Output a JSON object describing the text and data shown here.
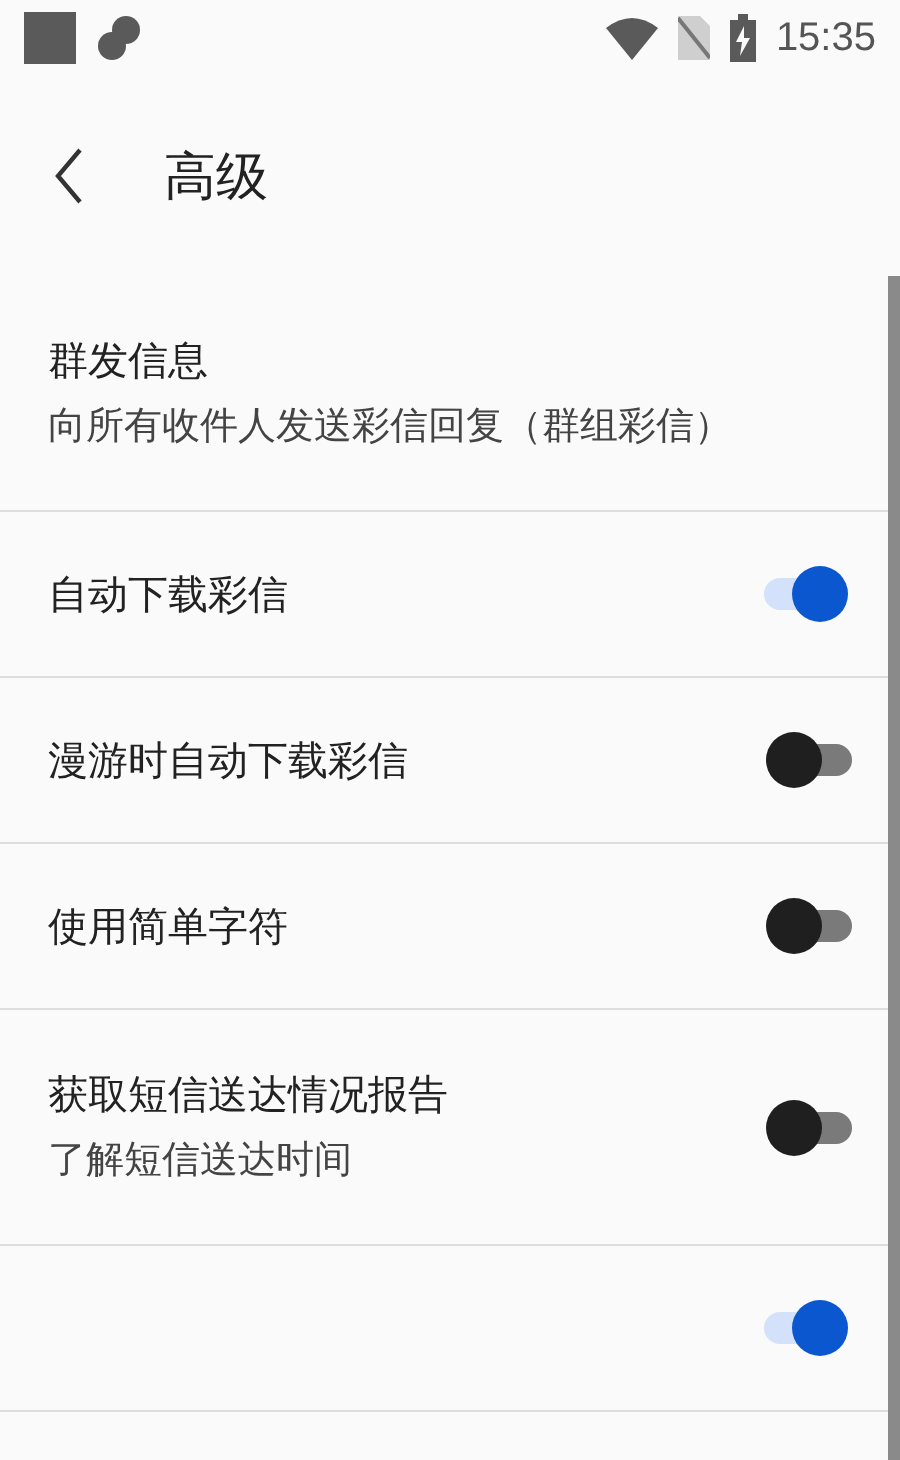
{
  "status_bar": {
    "time": "15:35"
  },
  "toolbar": {
    "title": "高级"
  },
  "settings": [
    {
      "kind": "text",
      "title": "群发信息",
      "summary": "向所有收件人发送彩信回复（群组彩信）"
    },
    {
      "kind": "switch",
      "title": "自动下载彩信",
      "on": true
    },
    {
      "kind": "switch",
      "title": "漫游时自动下载彩信",
      "on": false
    },
    {
      "kind": "switch",
      "title": "使用简单字符",
      "on": false
    },
    {
      "kind": "switch",
      "title": "获取短信送达情况报告",
      "summary": "了解短信送达时间",
      "on": false
    },
    {
      "kind": "switch",
      "on": true
    }
  ]
}
